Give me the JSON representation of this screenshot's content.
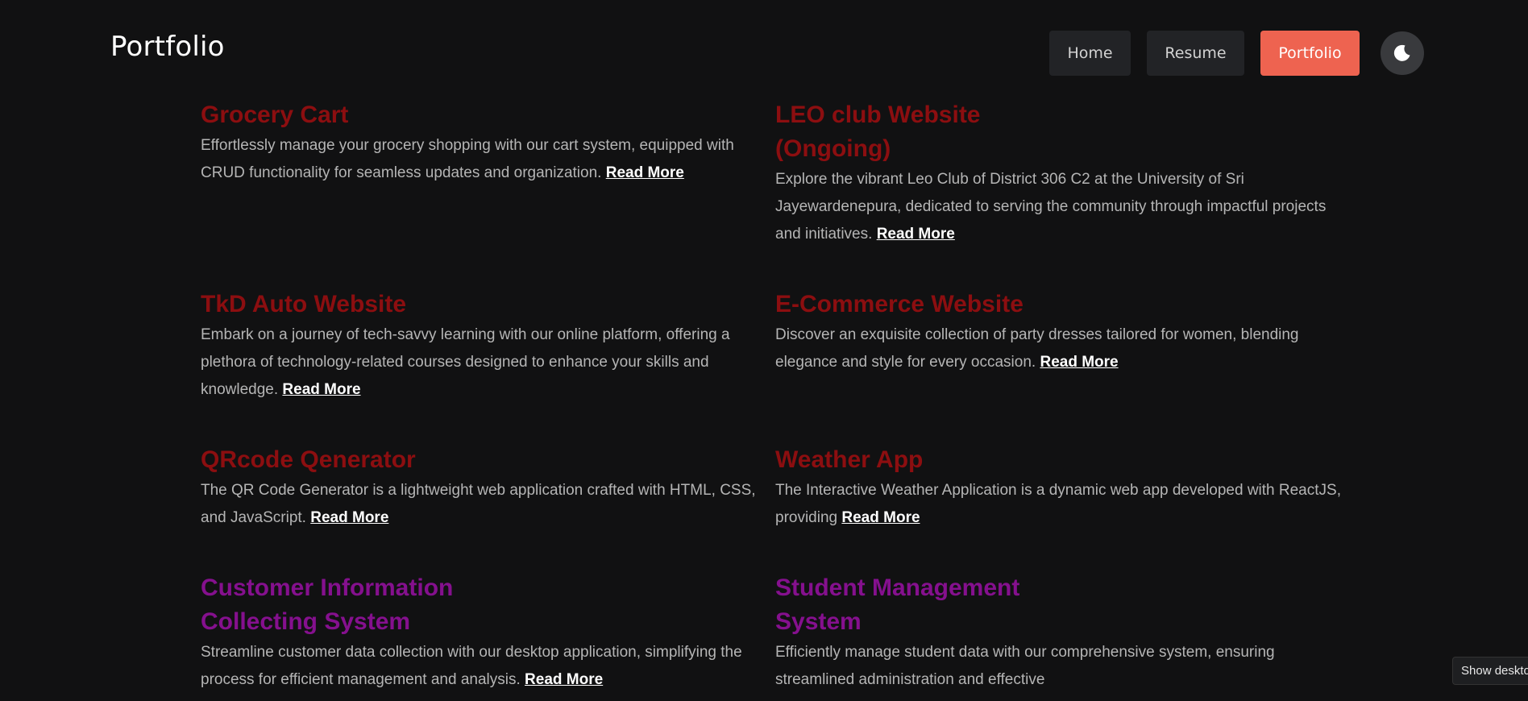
{
  "header": {
    "brand": "Portfolio",
    "nav": {
      "home": "Home",
      "resume": "Resume",
      "portfolio": "Portfolio"
    },
    "theme_icon": "moon-icon"
  },
  "projects": [
    {
      "title": "Grocery Cart",
      "description": "Effortlessly manage your grocery shopping with our cart system, equipped with CRUD functionality for seamless updates and organization.",
      "link": "Read More"
    },
    {
      "title": "LEO club Website (Ongoing)",
      "description": "Explore the vibrant Leo Club of District 306 C2 at the University of Sri Jayewardenepura, dedicated to serving the community through impactful projects and initiatives.",
      "link": "Read More"
    },
    {
      "title": "TkD Auto Website",
      "description": "Embark on a journey of tech-savvy learning with our online platform, offering a plethora of technology-related courses designed to enhance your skills and knowledge.",
      "link": "Read More"
    },
    {
      "title": "E-Commerce Website",
      "description": "Discover an exquisite collection of party dresses tailored for women, blending elegance and style for every occasion.",
      "link": "Read More"
    },
    {
      "title": "QRcode Qenerator",
      "description": "The QR Code Generator is a lightweight web application crafted with HTML, CSS, and JavaScript.",
      "link": "Read More"
    },
    {
      "title": "Weather App",
      "description": "The Interactive Weather Application is a dynamic web app developed with ReactJS, providing",
      "link": "Read More"
    },
    {
      "title": "Customer Information Collecting System",
      "description": "Streamline customer data collection with our desktop application, simplifying the process for efficient management and analysis.",
      "link": "Read More"
    },
    {
      "title": "Student Management System",
      "description": "Efficiently manage student data with our comprehensive system, ensuring streamlined administration and effective",
      "link": ""
    }
  ],
  "colors": {
    "background": "#111112",
    "title_red": "#8c0e10",
    "title_purple": "#85108e",
    "accent": "#ee6350"
  },
  "tooltip": "Show deskto"
}
